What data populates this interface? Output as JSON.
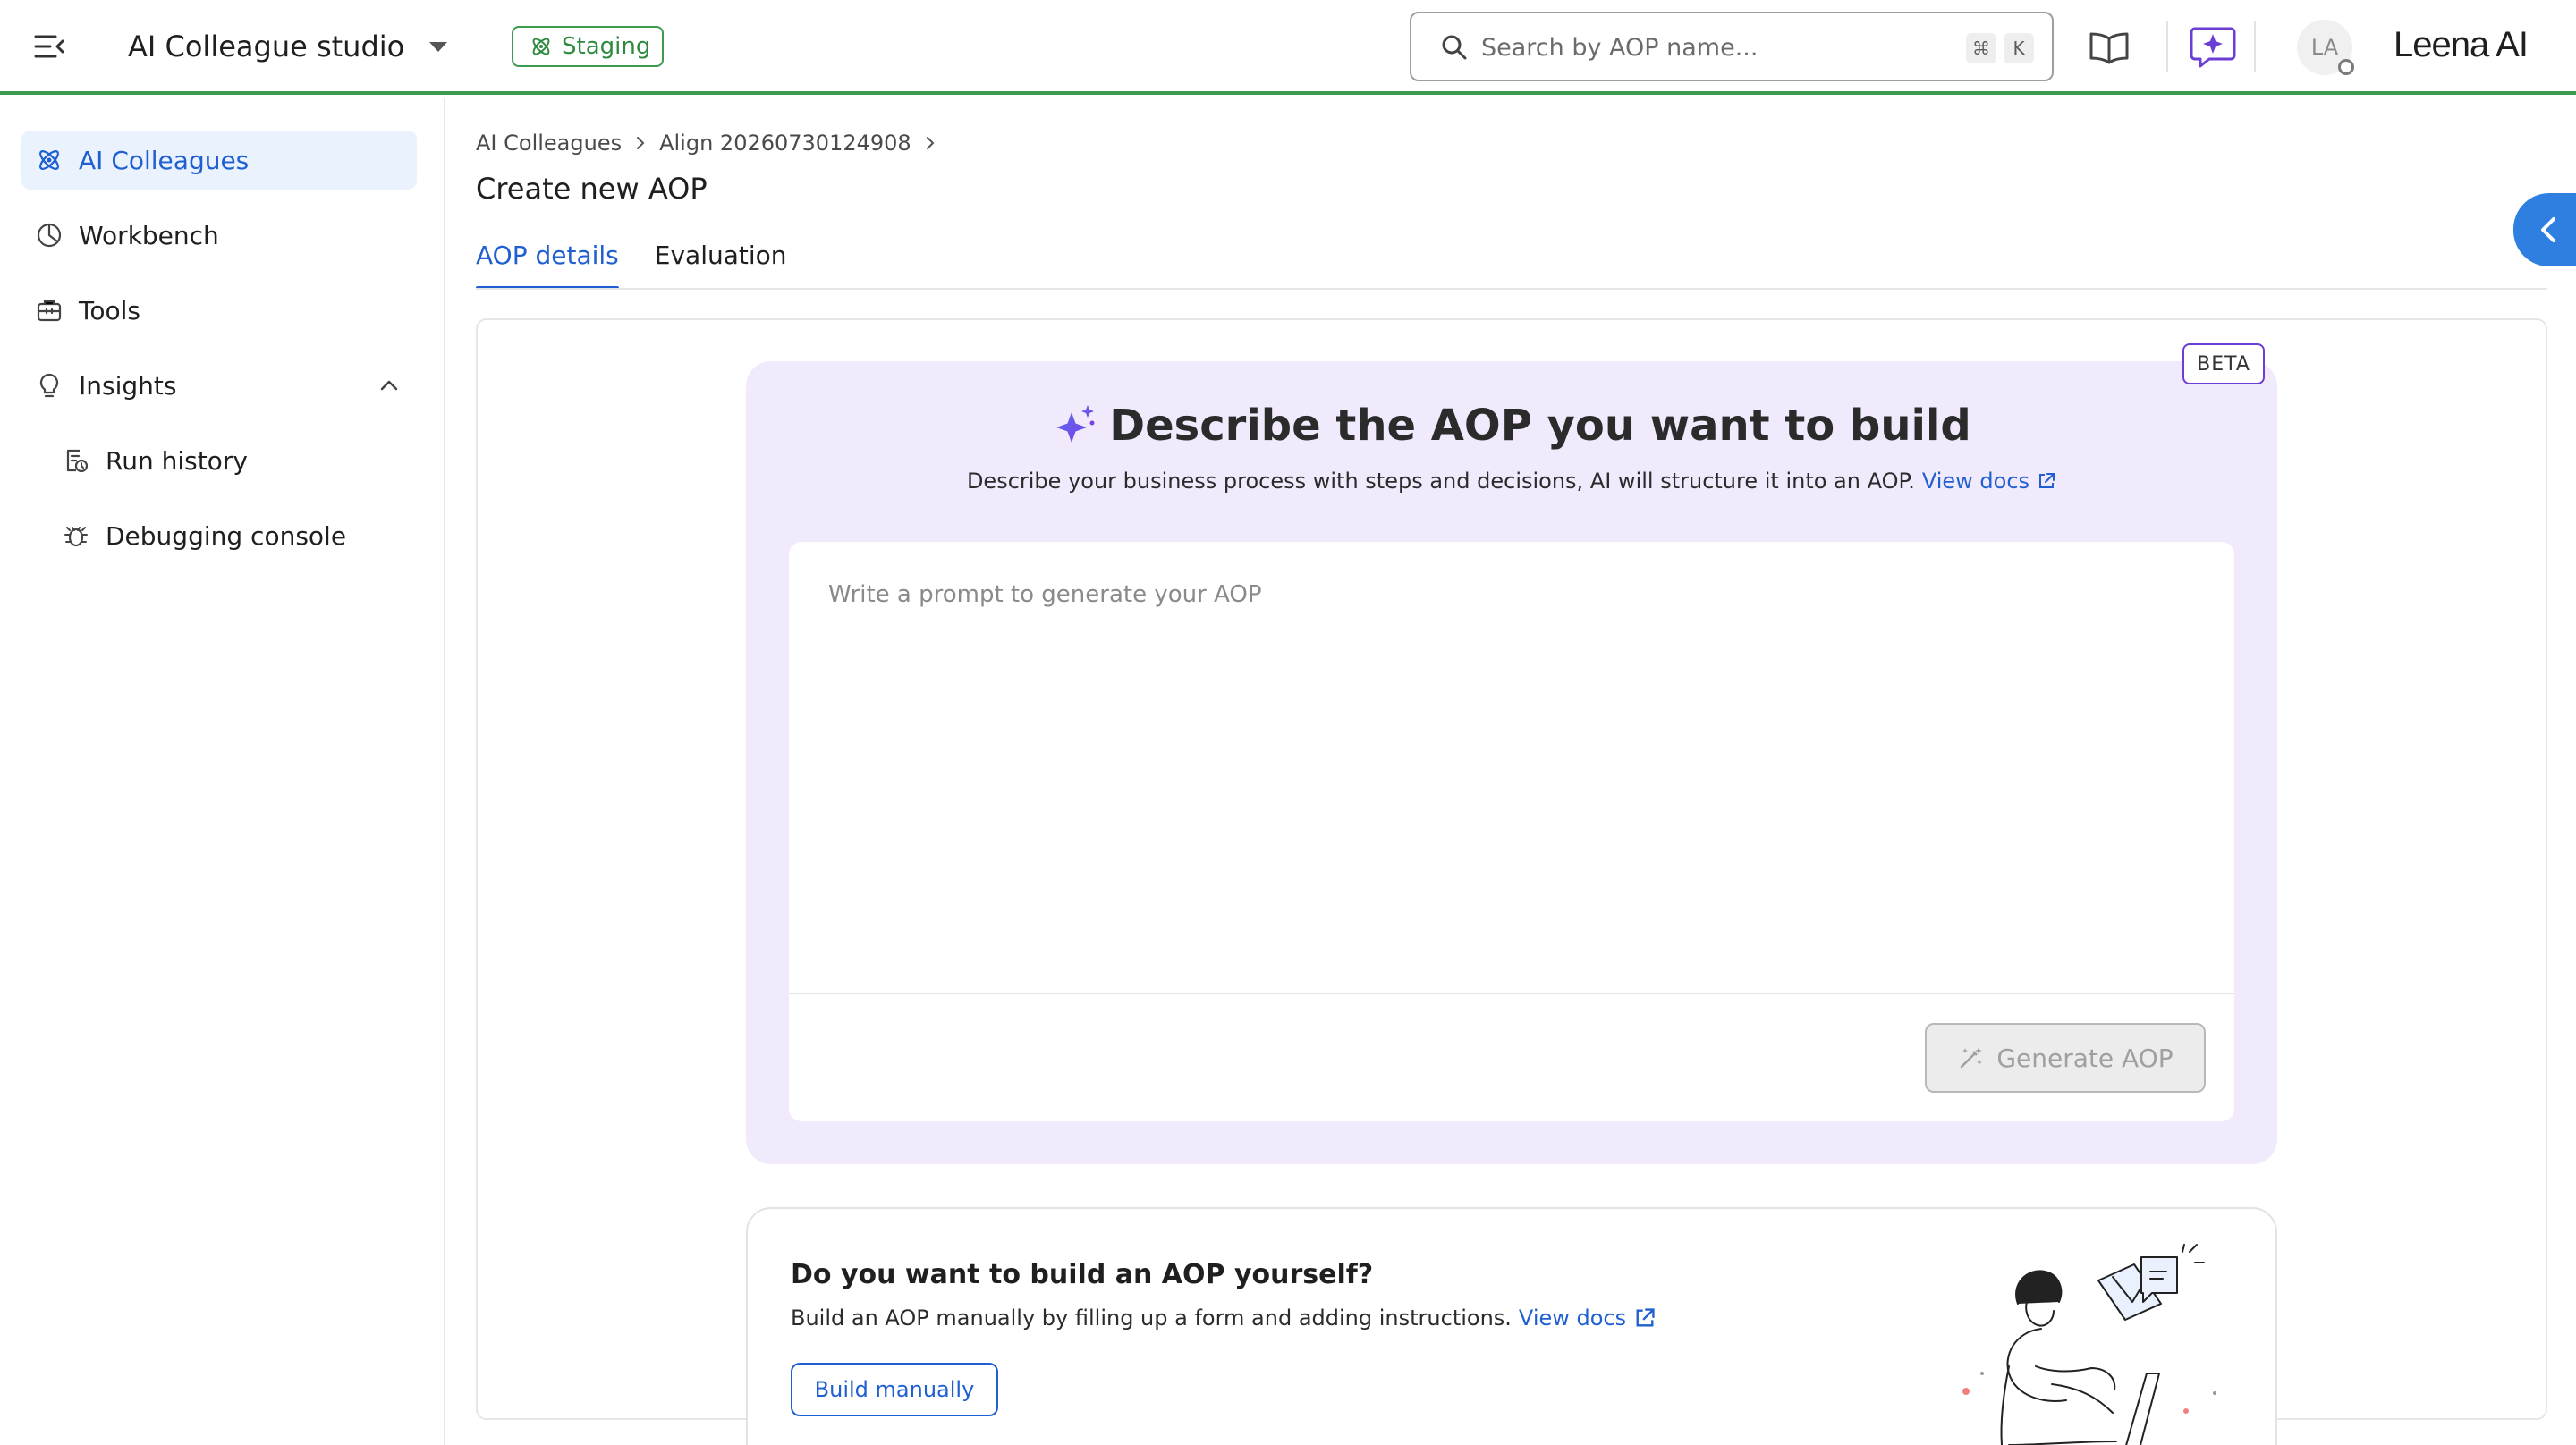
{
  "topbar": {
    "app_title": "AI Colleague studio",
    "env_badge": "Staging",
    "search_placeholder": "Search by AOP name...",
    "shortcut_keys": [
      "⌘",
      "K"
    ],
    "avatar_initials": "LA",
    "brand_name": "Leena AI"
  },
  "sidebar": {
    "items": [
      {
        "label": "AI Colleagues",
        "icon": "atom-icon",
        "active": true
      },
      {
        "label": "Workbench",
        "icon": "workbench-icon"
      },
      {
        "label": "Tools",
        "icon": "toolbox-icon"
      },
      {
        "label": "Insights",
        "icon": "lightbulb-icon",
        "expanded": true
      },
      {
        "label": "Run history",
        "icon": "history-icon"
      },
      {
        "label": "Debugging console",
        "icon": "bug-icon"
      }
    ]
  },
  "breadcrumb": [
    "AI Colleagues",
    "Align 20260730124908"
  ],
  "page_title": "Create new AOP",
  "tabs": [
    {
      "label": "AOP details",
      "active": true
    },
    {
      "label": "Evaluation",
      "active": false
    }
  ],
  "ai_panel": {
    "badge": "BETA",
    "heading": "Describe the AOP you want to build",
    "subtitle": "Describe your business process with steps and decisions, AI will structure it into an AOP.",
    "docs_link": "View docs",
    "prompt_placeholder": "Write a prompt to generate your AOP",
    "generate_label": "Generate AOP"
  },
  "manual_card": {
    "title": "Do you want to build an AOP yourself?",
    "subtitle": "Build an AOP manually by filling up a form and adding instructions.",
    "docs_link": "View docs",
    "button_label": "Build manually"
  },
  "colors": {
    "accent": "#1f5fd1",
    "env_green": "#3d9a4e",
    "ai_panel_bg": "#f0eafc",
    "beta_border": "#6b3fd6"
  }
}
